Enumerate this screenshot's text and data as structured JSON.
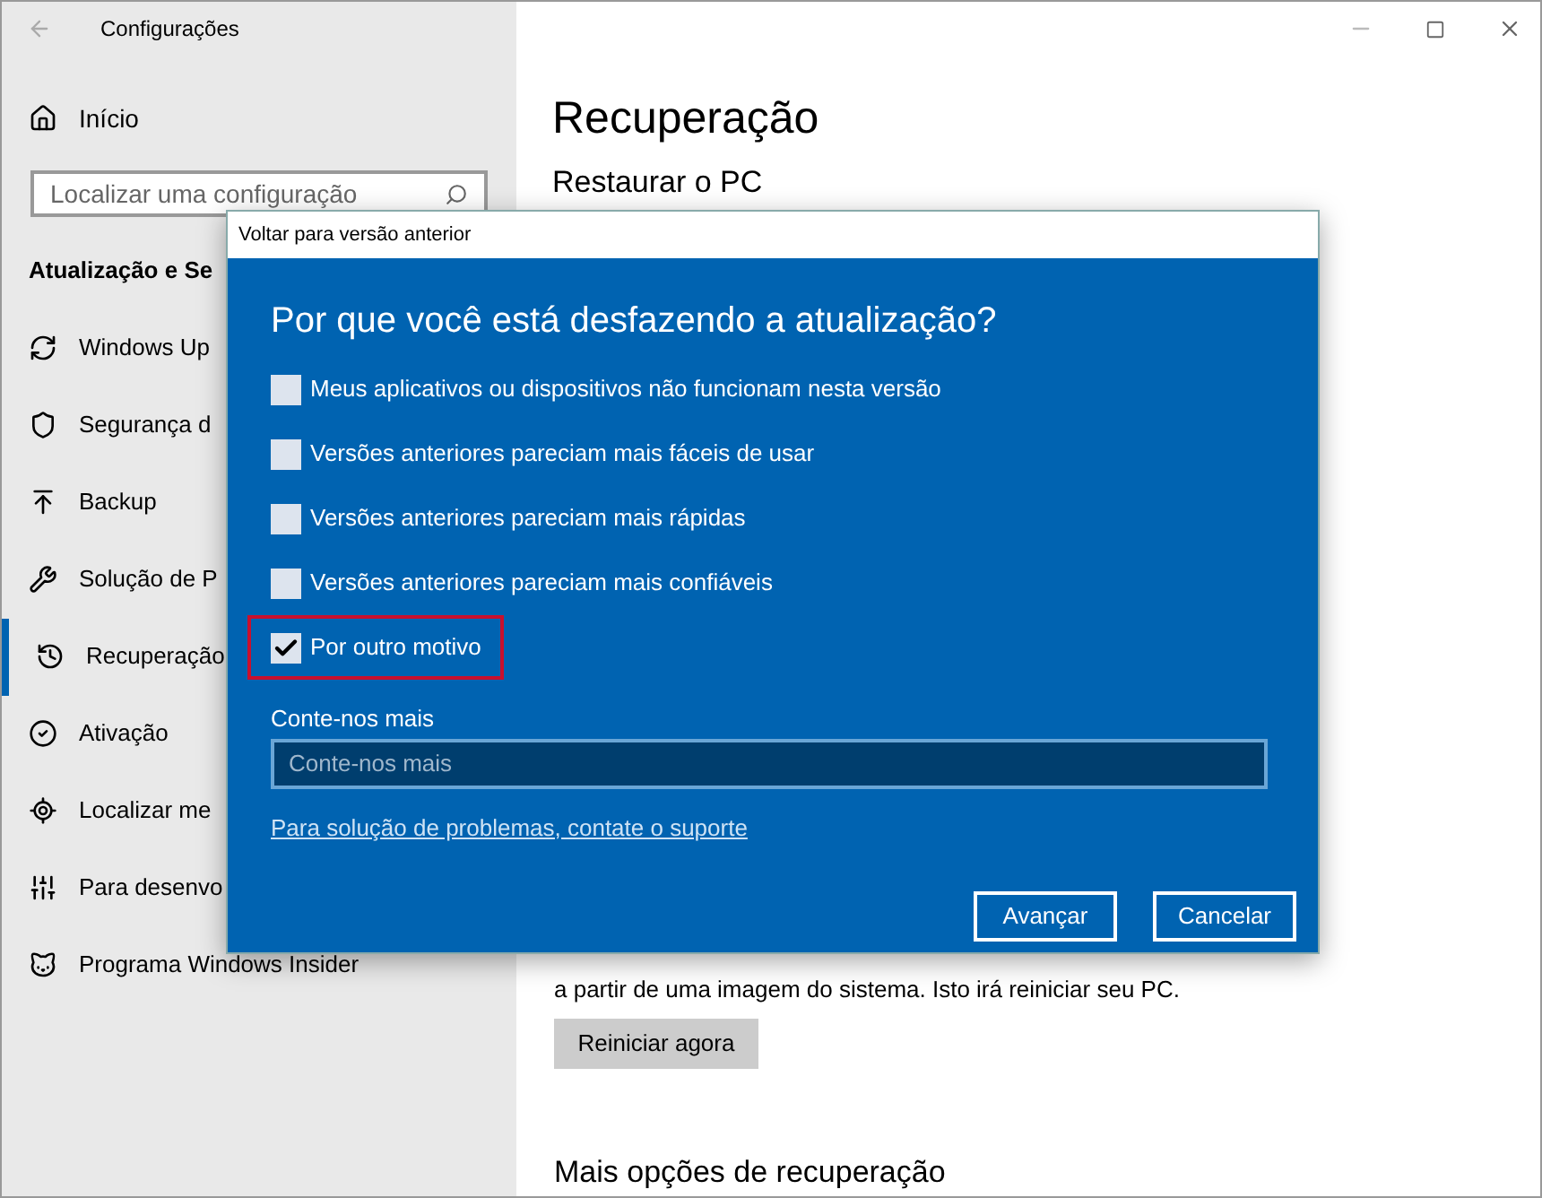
{
  "window": {
    "title": "Configurações"
  },
  "sidebar": {
    "home": "Início",
    "search": {
      "placeholder": "Localizar uma configuração"
    },
    "section": "Atualização e Se",
    "items": [
      {
        "label": "Windows Up",
        "selected": false
      },
      {
        "label": "Segurança d",
        "selected": false
      },
      {
        "label": "Backup",
        "selected": false
      },
      {
        "label": "Solução de P",
        "selected": false
      },
      {
        "label": "Recuperação",
        "selected": true
      },
      {
        "label": "Ativação",
        "selected": false
      },
      {
        "label": "Localizar me",
        "selected": false
      },
      {
        "label": "Para desenvo",
        "selected": false
      },
      {
        "label": "Programa Windows Insider",
        "selected": false
      }
    ]
  },
  "main": {
    "title": "Recuperação",
    "subtitle": "Restaurar o PC",
    "paragraph": "a partir de uma imagem do sistema. Isto irá reiniciar seu PC.",
    "button": "Reiniciar agora",
    "section": "Mais opções de recuperação"
  },
  "dialog": {
    "title": "Voltar para versão anterior",
    "heading": "Por que você está desfazendo a atualização?",
    "options": [
      {
        "label": "Meus aplicativos ou dispositivos não funcionam nesta versão",
        "checked": false,
        "highlighted": false
      },
      {
        "label": "Versões anteriores pareciam mais fáceis de usar",
        "checked": false,
        "highlighted": false
      },
      {
        "label": "Versões anteriores pareciam mais rápidas",
        "checked": false,
        "highlighted": false
      },
      {
        "label": "Versões anteriores pareciam mais confiáveis",
        "checked": false,
        "highlighted": false
      },
      {
        "label": "Por outro motivo",
        "checked": true,
        "highlighted": true
      }
    ],
    "field": {
      "label": "Conte-nos mais",
      "placeholder": "Conte-nos mais"
    },
    "link": "Para solução de problemas, contate o suporte",
    "buttons": [
      "Avançar",
      "Cancelar"
    ]
  }
}
